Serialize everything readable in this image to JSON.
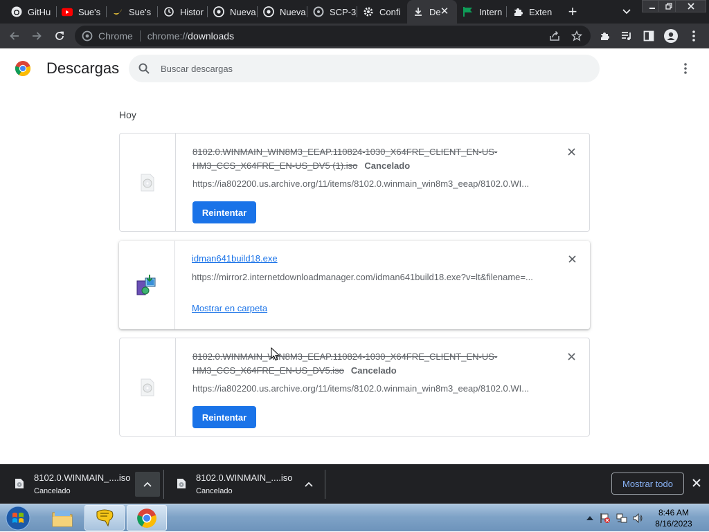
{
  "tabs": [
    {
      "title": "GitHu",
      "icon": "github-icon"
    },
    {
      "title": "Sue's",
      "icon": "youtube-icon"
    },
    {
      "title": "Sue's",
      "icon": "banana-icon"
    },
    {
      "title": "Histor",
      "icon": "history-icon"
    },
    {
      "title": "Nueva",
      "icon": "chrome-tab-icon"
    },
    {
      "title": "Nueva",
      "icon": "chrome-tab-icon"
    },
    {
      "title": "SCP-3",
      "icon": "scp-icon"
    },
    {
      "title": "Confi",
      "icon": "gear-icon"
    },
    {
      "title": "De",
      "icon": "download-icon",
      "active": true
    },
    {
      "title": "Intern",
      "icon": "flag-icon"
    },
    {
      "title": "Exten",
      "icon": "puzzle-icon"
    }
  ],
  "omnibox": {
    "site_label": "Chrome",
    "url_scheme": "chrome://",
    "url_host": "downloads"
  },
  "page": {
    "title": "Descargas",
    "search_placeholder": "Buscar descargas",
    "date_heading": "Hoy"
  },
  "downloads": [
    {
      "file_name": "8102.0.WINMAIN_WIN8M3_EEAP.110824-1030_X64FRE_CLIENT_EN-US-HM3_CCS_X64FRE_EN-US_DV5 (1).iso",
      "status": "Cancelado",
      "url": "https://ia802200.us.archive.org/11/items/8102.0.winmain_win8m3_eeap/8102.0.WI...",
      "action": "Reintentar",
      "state": "cancelled"
    },
    {
      "file_name": "idman641build18.exe",
      "status": "",
      "url": "https://mirror2.internetdownloadmanager.com/idman641build18.exe?v=lt&filename=...",
      "action": "Mostrar en carpeta",
      "state": "complete"
    },
    {
      "file_name": "8102.0.WINMAIN_WIN8M3_EEAP.110824-1030_X64FRE_CLIENT_EN-US-HM3_CCS_X64FRE_EN-US_DV5.iso",
      "status": "Cancelado",
      "url": "https://ia802200.us.archive.org/11/items/8102.0.winmain_win8m3_eeap/8102.0.WI...",
      "action": "Reintentar",
      "state": "cancelled"
    }
  ],
  "shelf": {
    "items": [
      {
        "name": "8102.0.WINMAIN_....iso",
        "status": "Cancelado"
      },
      {
        "name": "8102.0.WINMAIN_....iso",
        "status": "Cancelado"
      }
    ],
    "show_all": "Mostrar todo"
  },
  "taskbar": {
    "apps": [
      "explorer-icon",
      "messenger-icon",
      "chrome-icon"
    ],
    "time": "8:46 AM",
    "date": "8/16/2023"
  },
  "colors": {
    "accent": "#1a73e8",
    "tab_strip": "#202124",
    "toolbar": "#35363a"
  }
}
